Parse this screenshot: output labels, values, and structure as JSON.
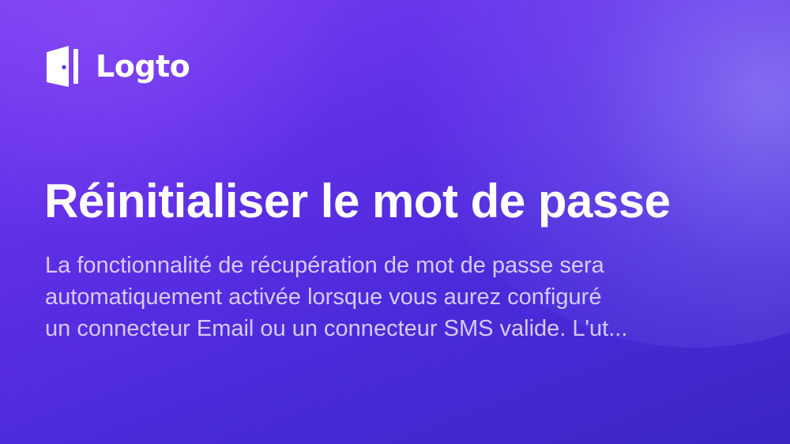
{
  "brand": {
    "name": "Logto"
  },
  "title": "Réinitialiser le mot de passe",
  "description": {
    "lines": [
      "La fonctionnalité de récupération de mot de passe sera",
      "automatiquement activée lorsque vous aurez configuré",
      "un connecteur Email ou un connecteur SMS valide. L'ut..."
    ]
  },
  "icons": {
    "logo": "door-logo-icon"
  },
  "colors": {
    "background_top": "#7a3ff0",
    "background_bottom": "#3b26c4",
    "text": "#ffffff",
    "description_text": "#ebe4ff"
  }
}
